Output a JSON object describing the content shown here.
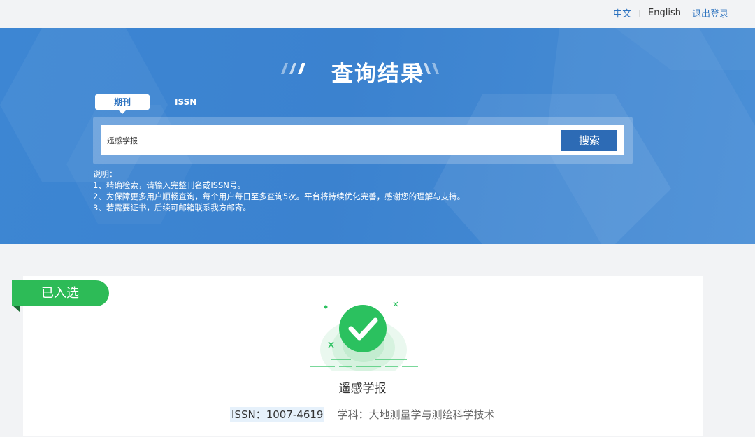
{
  "topbar": {
    "lang_zh": "中文",
    "separator": "|",
    "lang_en": "English",
    "logout": "退出登录"
  },
  "hero": {
    "title": "查询结果"
  },
  "tabs": {
    "journal": "期刊",
    "issn": "ISSN"
  },
  "search": {
    "value": "遥感学报",
    "button": "搜索"
  },
  "notes": {
    "heading": "说明：",
    "line1": "1、精确检索，请输入完整刊名或ISSN号。",
    "line2": "2、为保障更多用户顺畅查询，每个用户每日至多查询5次。平台将持续优化完善，感谢您的理解与支持。",
    "line3": "3、若需要证书，后续可邮箱联系我方邮寄。"
  },
  "result": {
    "badge": "已入选",
    "journal_name": "遥感学报",
    "issn": "ISSN：1007-4619",
    "subject": "学科：大地测量学与测绘科学技术"
  },
  "colors": {
    "brand_blue": "#3b82cf",
    "button_blue": "#2d6bb5",
    "success_green": "#2dbb57"
  },
  "icons": {
    "result_icon": "check-circle-icon"
  }
}
